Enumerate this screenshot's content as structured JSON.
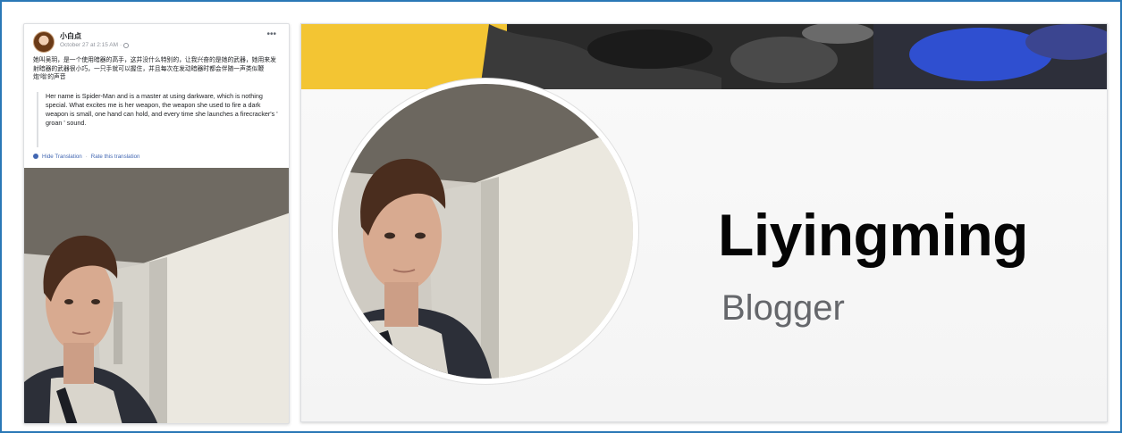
{
  "post": {
    "author": "小白点",
    "timestamp": "October 27 at 2:15 AM",
    "audience_icon": "globe-icon",
    "more_label": "•••",
    "original_text": "她叫吴玥，是一个使用暗器的高手，这并没什么特别的，让我兴奋的是她的武器，她用来发射暗器的武器很小巧，一只手就可以握住，并且每次在发动暗器时都会伴随一声类似鞭炮'嗡'的声音",
    "translation_text": "Her name is Spider-Man and is a master at using darkware, which is nothing special. What excites me is her weapon, the weapon she used to fire a dark weapon is small, one hand can hold, and every time she launches a firecracker's ' groan ' sound.",
    "hide_translation": "Hide Translation",
    "separator": "·",
    "rate_translation": "Rate this translation"
  },
  "profile": {
    "name": "Liyingming",
    "subtitle": "Blogger"
  },
  "colors": {
    "frame_border": "#2a78b6",
    "link": "#4267b2",
    "cover_yellow": "#f3c533",
    "cover_dark": "#262626",
    "cover_blue": "#2f4fd0"
  }
}
